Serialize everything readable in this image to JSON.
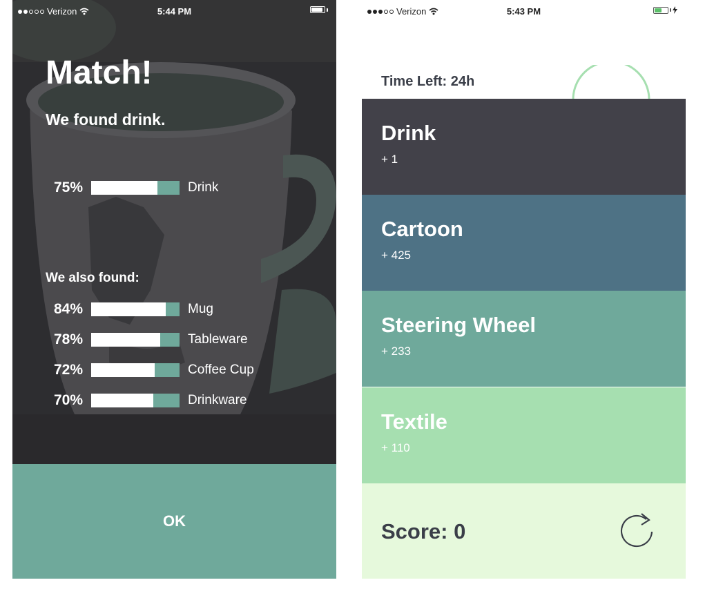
{
  "left": {
    "status": {
      "carrier": "Verizon",
      "time": "5:44 PM"
    },
    "title": "Match!",
    "found_text": "We found drink.",
    "primary": {
      "percent": "75%",
      "fraction": 0.75,
      "label": "Drink"
    },
    "also_found_label": "We also found:",
    "also_found": [
      {
        "percent": "84%",
        "fraction": 0.84,
        "label": "Mug"
      },
      {
        "percent": "78%",
        "fraction": 0.78,
        "label": "Tableware"
      },
      {
        "percent": "72%",
        "fraction": 0.72,
        "label": "Coffee Cup"
      },
      {
        "percent": "70%",
        "fraction": 0.7,
        "label": "Drinkware"
      }
    ],
    "ok_label": "OK"
  },
  "right": {
    "status": {
      "carrier": "Verizon",
      "time": "5:43 PM"
    },
    "time_left_label": "Time Left:",
    "time_left_value": "24h",
    "categories": [
      {
        "name": "Drink",
        "points": "+ 1",
        "color": "#424149",
        "text_color": "#ffffff"
      },
      {
        "name": "Cartoon",
        "points": "+ 425",
        "color": "#4e7285",
        "text_color": "#ffffff"
      },
      {
        "name": "Steering Wheel",
        "points": "+ 233",
        "color": "#6fa99b",
        "text_color": "#ffffff"
      },
      {
        "name": "Textile",
        "points": "+ 110",
        "color": "#a6dfb0",
        "text_color": "#ffffff"
      }
    ],
    "score_label": "Score: 0"
  },
  "colors": {
    "teal": "#6fa99b",
    "score_bg": "#e6f9dc",
    "dark_text": "#3a3e48"
  },
  "icons": [
    "wifi-icon",
    "battery-icon",
    "charging-bolt-icon",
    "refresh-icon",
    "timer-ring-icon"
  ]
}
